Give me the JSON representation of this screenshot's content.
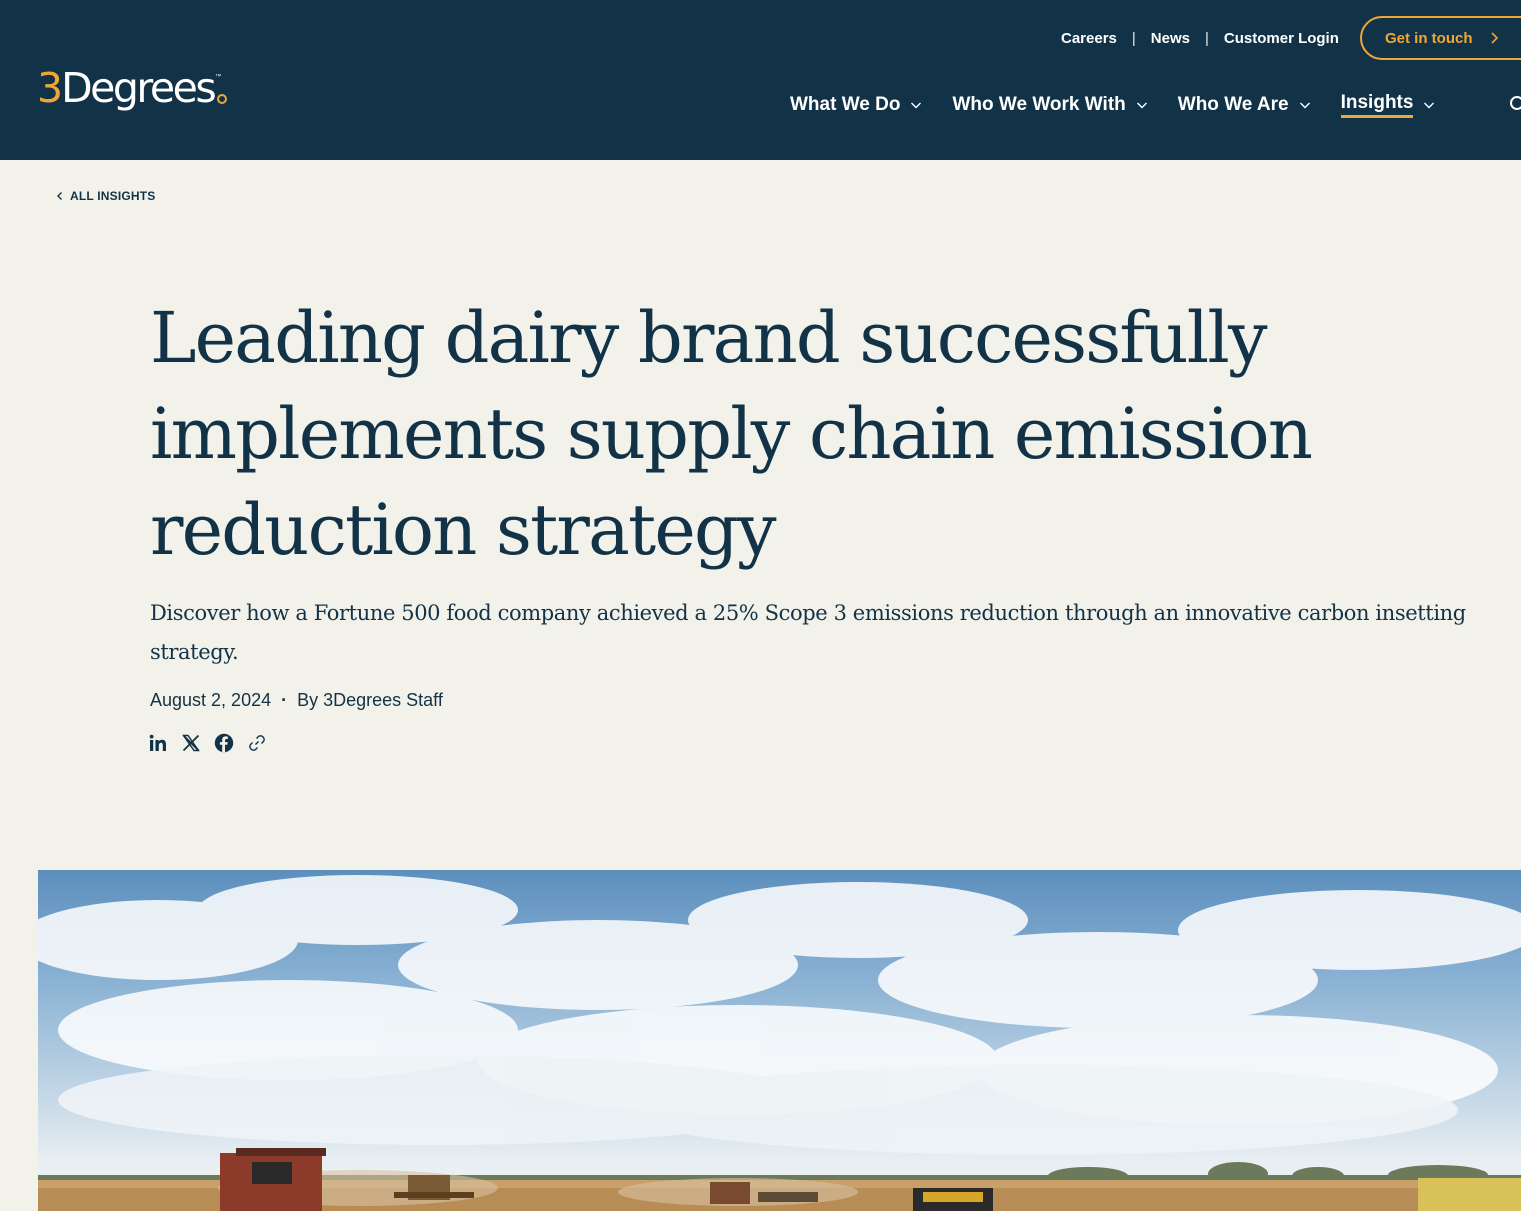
{
  "brand": {
    "logo_numeral": "3",
    "logo_word": "Degrees",
    "logo_tm": "™",
    "accent_color": "#f0a735",
    "header_color": "#123347",
    "background_color": "#f2f1ea"
  },
  "utility_nav": {
    "careers": "Careers",
    "news": "News",
    "login": "Customer Login",
    "separator": "|"
  },
  "cta": {
    "label": "Get in touch",
    "icon": "chevron-right-icon"
  },
  "main_nav": {
    "items": [
      {
        "label": "What We Do",
        "icon": "chevron-down-icon"
      },
      {
        "label": "Who We Work With",
        "icon": "chevron-down-icon"
      },
      {
        "label": "Who We Are",
        "icon": "chevron-down-icon"
      },
      {
        "label": "Insights",
        "icon": "chevron-down-icon",
        "active": true
      }
    ],
    "search_icon": "search-icon"
  },
  "back_link": {
    "label": "ALL INSIGHTS",
    "icon": "chevron-left-icon"
  },
  "article": {
    "title": "Leading dairy brand successfully implements supply chain emission reduction strategy",
    "subtitle": "Discover how a Fortune 500 food company achieved a 25% Scope 3 emissions reduction through an innovative carbon insetting strategy.",
    "date": "August 2, 2024",
    "meta_separator": "·",
    "author": "By 3Degrees Staff"
  },
  "share": {
    "icons": [
      "linkedin-icon",
      "x-icon",
      "facebook-icon",
      "link-icon"
    ]
  },
  "hero": {
    "description_icon": "hero-image"
  }
}
